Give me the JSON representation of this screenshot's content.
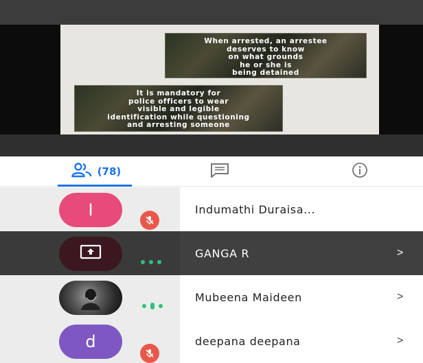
{
  "video": {
    "caption_top": [
      "When arrested, an arrestee",
      "deserves to know",
      "on what grounds",
      "he or she is",
      "being detained"
    ],
    "caption_bottom": [
      "It is mandatory for",
      "police officers to wear",
      "visible and legible",
      "identification while questioning",
      "and arresting someone"
    ]
  },
  "tabs": {
    "people_count": "(78)",
    "people_icon": "people-icon",
    "chat_icon": "chat-icon",
    "info_icon": "info-icon",
    "accent_color": "#1a73e8"
  },
  "participants": [
    {
      "name": "Indumathi Duraisa...",
      "avatar_letter": "I",
      "avatar_color": "#e84b7a",
      "status": "muted",
      "chevron": ""
    },
    {
      "name": "GANGA R",
      "avatar_icon": "present-screen-icon",
      "avatar_color": "#3b1820",
      "status": "more",
      "chevron": ">"
    },
    {
      "name": "Mubeena Maideen",
      "avatar_icon": "photo-avatar",
      "status": "speaking",
      "chevron": ">"
    },
    {
      "name": "deepana deepana",
      "avatar_letter": "d",
      "avatar_color": "#7e57c2",
      "status": "muted",
      "chevron": ">"
    }
  ]
}
